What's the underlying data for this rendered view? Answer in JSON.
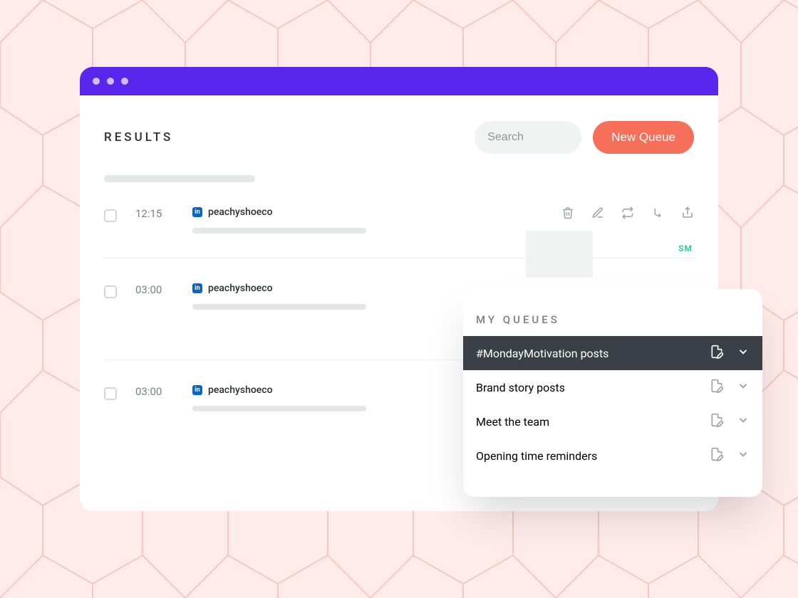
{
  "header": {
    "title": "RESULTS",
    "search_placeholder": "Search",
    "new_queue_label": "New Queue"
  },
  "posts": [
    {
      "time": "12:15",
      "account": "peachyshoeco",
      "expanded": true,
      "badge": "SM"
    },
    {
      "time": "03:00",
      "account": "peachyshoeco",
      "expanded": false
    },
    {
      "time": "03:00",
      "account": "peachyshoeco",
      "expanded": false
    }
  ],
  "queues_panel": {
    "title": "MY QUEUES",
    "items": [
      {
        "label": "#MondayMotivation posts",
        "selected": true
      },
      {
        "label": "Brand story posts",
        "selected": false
      },
      {
        "label": "Meet the team",
        "selected": false
      },
      {
        "label": "Opening time reminders",
        "selected": false
      }
    ]
  }
}
